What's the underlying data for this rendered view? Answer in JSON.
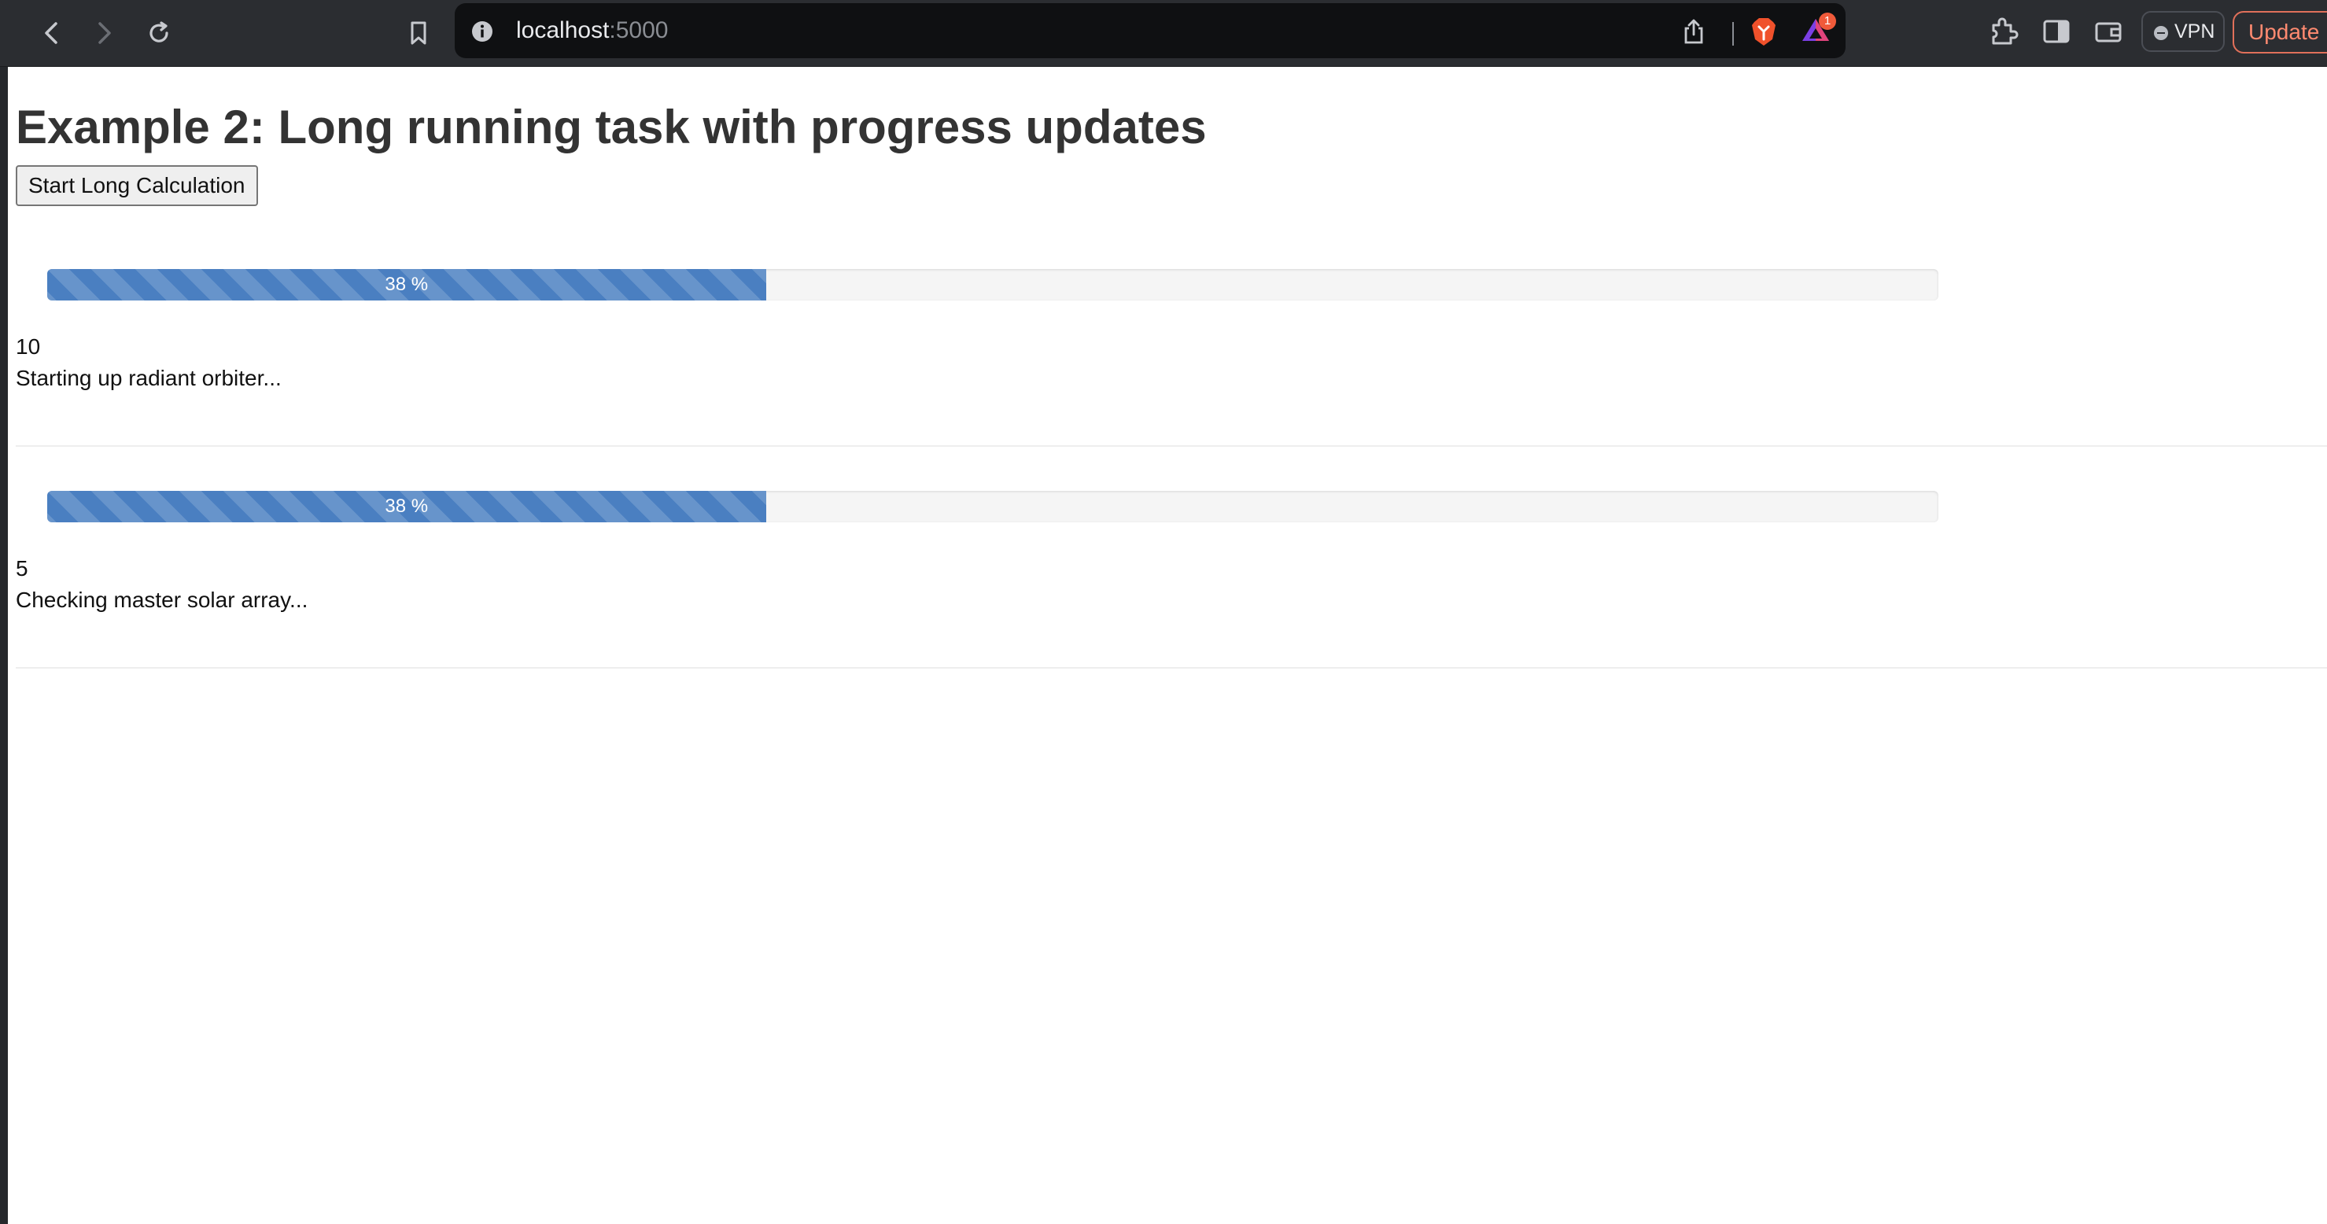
{
  "browser": {
    "url_host": "localhost",
    "url_port": ":5000",
    "rewards_badge": "1",
    "vpn_label": "VPN",
    "update_label": "Update",
    "icons": [
      "back-arrow-icon",
      "forward-arrow-icon",
      "reload-icon",
      "bookmark-icon",
      "info-icon",
      "share-icon",
      "brave-shield-icon",
      "brave-rewards-icon",
      "extensions-icon",
      "sidebar-icon",
      "wallet-icon"
    ],
    "colors": {
      "chrome_bg": "#2b2d31",
      "urlbar_bg": "#0f1012",
      "update_accent": "#ff8a70"
    }
  },
  "page": {
    "title": "Example 2: Long running task with progress updates",
    "start_button": "Start Long Calculation"
  },
  "tasks": [
    {
      "progress_label": "38 %",
      "progress_percent": 38,
      "count": "10",
      "status": "Starting up radiant orbiter..."
    },
    {
      "progress_label": "38 %",
      "progress_percent": 38,
      "count": "5",
      "status": "Checking master solar array..."
    }
  ],
  "colors": {
    "progress_bar": "#4a7fc1",
    "progress_track": "#f5f5f5",
    "title_text": "#333333"
  }
}
